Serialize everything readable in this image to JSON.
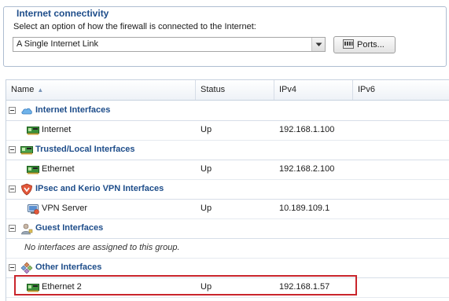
{
  "connectivity": {
    "title": "Internet connectivity",
    "prompt": "Select an option of how the firewall is connected to the Internet:",
    "selected_option": "A Single Internet Link",
    "ports_button": "Ports..."
  },
  "grid": {
    "columns": [
      {
        "label": "Name",
        "sorted": "ascending"
      },
      {
        "label": "Status"
      },
      {
        "label": "IPv4"
      },
      {
        "label": "IPv6"
      }
    ],
    "groups": [
      {
        "title": "Internet Interfaces",
        "icon": "cloud-icon",
        "rows": [
          {
            "name": "Internet",
            "status": "Up",
            "ipv4": "192.168.1.100",
            "ipv6": ""
          }
        ]
      },
      {
        "title": "Trusted/Local Interfaces",
        "icon": "network-card-icon",
        "rows": [
          {
            "name": "Ethernet",
            "status": "Up",
            "ipv4": "192.168.2.100",
            "ipv6": ""
          }
        ]
      },
      {
        "title": "IPsec and Kerio VPN Interfaces",
        "icon": "vpn-shield-icon",
        "rows": [
          {
            "name": "VPN Server",
            "status": "Up",
            "ipv4": "10.189.109.1",
            "ipv6": ""
          }
        ]
      },
      {
        "title": "Guest Interfaces",
        "icon": "guest-user-icon",
        "empty_note": "No interfaces are assigned to this group."
      },
      {
        "title": "Other Interfaces",
        "icon": "diamonds-icon",
        "rows": [
          {
            "name": "Ethernet 2",
            "status": "Up",
            "ipv4": "192.168.1.57",
            "ipv6": ""
          }
        ]
      }
    ]
  },
  "colors": {
    "group_title": "#1e4d8a",
    "highlight_border": "#c9252c",
    "header_border": "#c7d2df"
  }
}
